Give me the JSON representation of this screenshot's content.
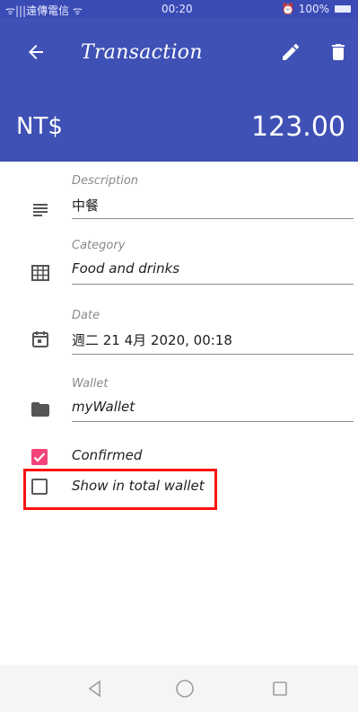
{
  "status_bar": {
    "carrier": "ᯤ|||遠傳電信 ᯤ",
    "time": "00:20",
    "battery": "100%"
  },
  "app_bar": {
    "title": "Transaction"
  },
  "header": {
    "currency": "NT$",
    "amount": "123.00"
  },
  "fields": {
    "description": {
      "label": "Description",
      "value": "中餐"
    },
    "category": {
      "label": "Category",
      "value": "Food and drinks"
    },
    "date": {
      "label": "Date",
      "value": "週二 21 4月 2020, 00:18"
    },
    "wallet": {
      "label": "Wallet",
      "value": "myWallet"
    }
  },
  "checkboxes": {
    "confirmed": {
      "label": "Confirmed",
      "checked": true
    },
    "show_in_total": {
      "label": "Show in total wallet",
      "checked": false
    }
  },
  "colors": {
    "primary": "#3f51b5",
    "accent": "#f24478",
    "highlight": "#ff1010"
  },
  "icons": {
    "back": "arrow-back-icon",
    "edit": "pencil-icon",
    "delete": "trash-icon",
    "description": "notes-icon",
    "category": "grid-icon",
    "date": "calendar-icon",
    "wallet": "folder-icon",
    "nav_back": "triangle-back-icon",
    "nav_home": "circle-home-icon",
    "nav_recents": "square-recents-icon"
  }
}
